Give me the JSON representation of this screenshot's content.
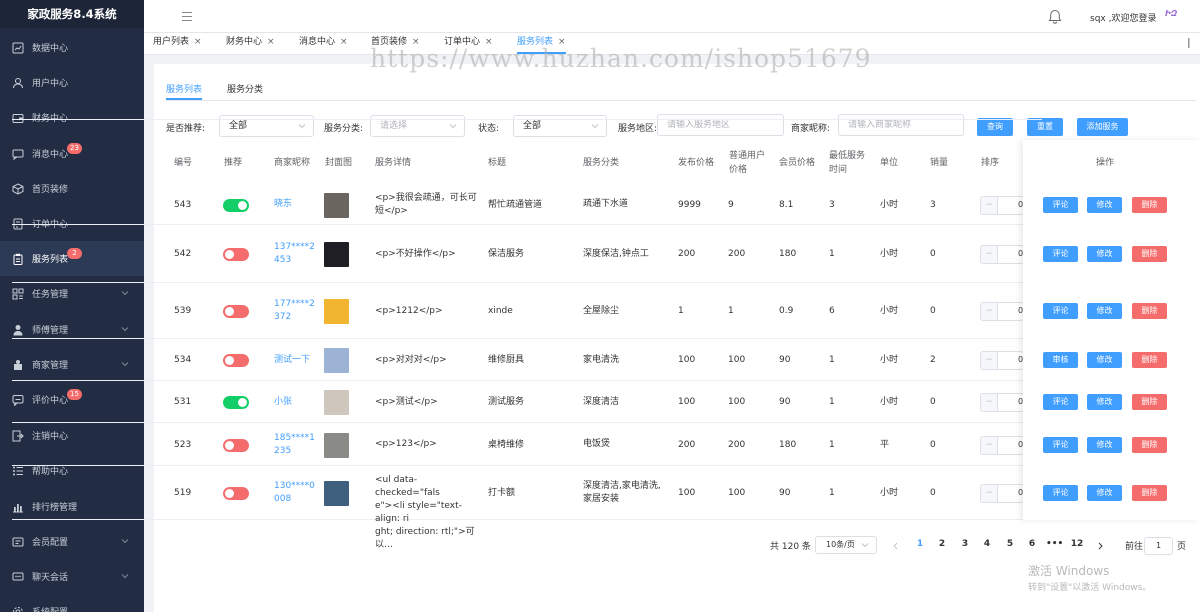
{
  "sidebar": {
    "title": "家政服务8.4系统",
    "items": [
      {
        "label": "数据中心",
        "icon": "dashboard-icon"
      },
      {
        "label": "用户中心",
        "icon": "user-icon"
      },
      {
        "label": "财务中心",
        "icon": "wallet-icon"
      },
      {
        "label": "消息中心",
        "icon": "message-icon",
        "badge": "23"
      },
      {
        "label": "首页装修",
        "icon": "cube-icon"
      },
      {
        "label": "订单中心",
        "icon": "order-icon"
      },
      {
        "label": "服务列表",
        "icon": "clipboard-icon",
        "badge": "2",
        "active": true
      },
      {
        "label": "任务管理",
        "icon": "grid-icon",
        "expandable": true
      },
      {
        "label": "师傅管理",
        "icon": "worker-icon",
        "expandable": true
      },
      {
        "label": "商家管理",
        "icon": "merchant-icon",
        "expandable": true
      },
      {
        "label": "评价中心",
        "icon": "comment-icon",
        "badge": "15"
      },
      {
        "label": "注销中心",
        "icon": "logout-icon"
      },
      {
        "label": "帮助中心",
        "icon": "list-icon"
      },
      {
        "label": "排行榜管理",
        "icon": "bar-chart-icon"
      },
      {
        "label": "会员配置",
        "icon": "member-icon",
        "expandable": true
      },
      {
        "label": "聊天会话",
        "icon": "chat-icon",
        "expandable": true
      },
      {
        "label": "系统配置",
        "icon": "settings-icon"
      }
    ]
  },
  "header": {
    "welcome": "sqx ,欢迎您登录",
    "avatar_text": "ԻԶ"
  },
  "tabs": [
    {
      "label": "用户列表",
      "close": "×"
    },
    {
      "label": "财务中心",
      "close": "×"
    },
    {
      "label": "消息中心",
      "close": "×"
    },
    {
      "label": "首页装修",
      "close": "×"
    },
    {
      "label": "订单中心",
      "close": "×"
    },
    {
      "label": "服务列表",
      "close": "×",
      "active": true
    }
  ],
  "watermark": "https://www.huzhan.com/ishop51679",
  "subtabs": {
    "list": "服务列表",
    "category": "服务分类"
  },
  "filters": {
    "recommend_label": "是否推荐:",
    "recommend_value": "全部",
    "category_label": "服务分类:",
    "category_placeholder": "请选择",
    "status_label": "状态:",
    "status_value": "全部",
    "region_label": "服务地区:",
    "region_placeholder": "请输入服务地区",
    "merchant_label": "商家昵称:",
    "merchant_placeholder": "请输入商家昵称",
    "query_btn": "查询",
    "reset_btn": "重置",
    "add_btn": "添加服务"
  },
  "table": {
    "headers": {
      "id": "编号",
      "recommend": "推荐",
      "merchant": "商家昵称",
      "cover": "封面图",
      "detail": "服务详情",
      "title": "标题",
      "category": "服务分类",
      "price": "发布价格",
      "user_price_1": "普通用户",
      "user_price_2": "价格",
      "member_price": "会员价格",
      "min_time_1": "最低服务",
      "min_time_2": "时间",
      "unit": "单位",
      "sales": "销量",
      "sort": "排序",
      "actions": "操作"
    },
    "rows": [
      {
        "id": "543",
        "on": true,
        "merchant": [
          "晓东"
        ],
        "detail": [
          "<p>我很会疏通，可长可",
          "短</p>"
        ],
        "title": "帮忙疏通管道",
        "category": [
          "疏通下水道"
        ],
        "price": "9999",
        "user_price": "9",
        "member_price": "8.1",
        "min_time": "3",
        "unit": "小时",
        "sales": "3",
        "sort": "0",
        "btn1": "评论",
        "btn2": "修改",
        "btn3": "删除",
        "thumb": "#6b6560"
      },
      {
        "id": "542",
        "on": false,
        "merchant": [
          "137****2",
          "453"
        ],
        "detail": [
          "<p>不好操作</p>"
        ],
        "title": "保洁服务",
        "category": [
          "深度保洁,钟点工"
        ],
        "price": "200",
        "user_price": "200",
        "member_price": "180",
        "min_time": "1",
        "unit": "小时",
        "sales": "0",
        "sort": "0",
        "btn1": "评论",
        "btn2": "修改",
        "btn3": "删除",
        "thumb": "#1e1e24"
      },
      {
        "id": "539",
        "on": false,
        "merchant": [
          "177****2",
          "372"
        ],
        "detail": [
          "<p>1212</p>"
        ],
        "title": "xinde",
        "category": [
          "全屋除尘"
        ],
        "price": "1",
        "user_price": "1",
        "member_price": "0.9",
        "min_time": "6",
        "unit": "小时",
        "sales": "0",
        "sort": "0",
        "btn1": "评论",
        "btn2": "修改",
        "btn3": "删除",
        "thumb": "#f2b530"
      },
      {
        "id": "534",
        "on": false,
        "merchant": [
          "测试一下"
        ],
        "detail": [
          "<p>对对对</p>"
        ],
        "title": "维修厨具",
        "category": [
          "家电清洗"
        ],
        "price": "100",
        "user_price": "100",
        "member_price": "90",
        "min_time": "1",
        "unit": "小时",
        "sales": "2",
        "sort": "0",
        "btn1": "审核",
        "btn2": "修改",
        "btn3": "删除",
        "thumb": "#9cb3d6"
      },
      {
        "id": "531",
        "on": true,
        "merchant": [
          "小张"
        ],
        "detail": [
          "<p>测试</p>"
        ],
        "title": "测试服务",
        "category": [
          "深度清洁"
        ],
        "price": "100",
        "user_price": "100",
        "member_price": "90",
        "min_time": "1",
        "unit": "小时",
        "sales": "0",
        "sort": "0",
        "btn1": "评论",
        "btn2": "修改",
        "btn3": "删除",
        "thumb": "#cfc6bd"
      },
      {
        "id": "523",
        "on": false,
        "merchant": [
          "185****1",
          "235"
        ],
        "detail": [
          "<p>123</p>"
        ],
        "title": "桌椅维修",
        "category": [
          "电饭煲"
        ],
        "price": "200",
        "user_price": "200",
        "member_price": "180",
        "min_time": "1",
        "unit": "平",
        "sales": "0",
        "sort": "0",
        "btn1": "评论",
        "btn2": "修改",
        "btn3": "删除",
        "thumb": "#8a8a86"
      },
      {
        "id": "519",
        "on": false,
        "merchant": [
          "130****0",
          "008"
        ],
        "detail": [
          "<ul data-checked=\"fals",
          "e\"><li style=\"text-align: ri",
          "ght; direction: rtl;\">可以…"
        ],
        "title": "打卡额",
        "category": [
          "深度清洁,家电清洗,",
          "家居安装"
        ],
        "price": "100",
        "user_price": "100",
        "member_price": "90",
        "min_time": "1",
        "unit": "小时",
        "sales": "0",
        "sort": "0",
        "btn1": "评论",
        "btn2": "修改",
        "btn3": "删除",
        "thumb": "#3f5f7e"
      }
    ]
  },
  "pagination": {
    "total": "共 120 条",
    "page_size": "10条/页",
    "pages": [
      "1",
      "2",
      "3",
      "4",
      "5",
      "6",
      "•••",
      "12"
    ],
    "current": "1",
    "goto_label": "前往",
    "goto_value": "1",
    "goto_suffix": "页"
  },
  "os_watermark": {
    "line1": "激活 Windows",
    "line2": "转到\"设置\"以激活 Windows。"
  },
  "colors": {
    "sidebar": "#222d44",
    "accent": "#409eff",
    "danger": "#f56c6c",
    "success": "#13ce66"
  }
}
